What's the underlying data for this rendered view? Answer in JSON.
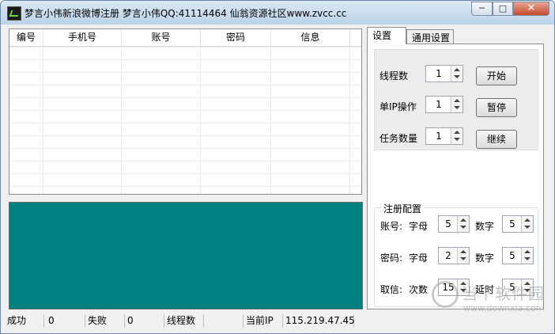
{
  "window": {
    "title": "梦言小伟新浪微博注册  梦言小伟QQ:41114464  仙翁资源社区www.zvcc.cc",
    "controls": {
      "minimize": "─",
      "maximize": "□",
      "close": "✕"
    }
  },
  "grid": {
    "columns": [
      "编号",
      "手机号",
      "账号",
      "密码",
      "信息"
    ]
  },
  "status_bar": {
    "success_label": "成功",
    "success_value": "0",
    "fail_label": "失败",
    "fail_value": "0",
    "threads_label": "线程数",
    "threads_value": "",
    "ip_label": "当前IP",
    "ip_value": "115.219.47.45"
  },
  "tabs": [
    "设置",
    "通用设置"
  ],
  "settings": {
    "threads_label": "线程数",
    "threads_value": "1",
    "single_ip_label": "单IP操作",
    "single_ip_value": "1",
    "task_count_label": "任务数量",
    "task_count_value": "1",
    "start_button": "开始",
    "pause_button": "暂停",
    "continue_button": "继续"
  },
  "register_config": {
    "legend": "注册配置",
    "account_label": "账号:",
    "account_letters_label": "字母",
    "account_letters_value": "5",
    "account_digits_label": "数字",
    "account_digits_value": "5",
    "password_label": "密码:",
    "password_letters_label": "字母",
    "password_letters_value": "2",
    "password_digits_label": "数字",
    "password_digits_value": "5",
    "fetch_label": "取信:",
    "retries_label": "次数",
    "retries_value": "15",
    "delay_label": "延时",
    "delay_value": "5"
  },
  "watermark": {
    "text": "当下软件园",
    "url": "www.downxia.com"
  },
  "colors": {
    "log_background": "#008080",
    "titlebar": "#bcd3ea",
    "close_button": "#c44a2d"
  }
}
